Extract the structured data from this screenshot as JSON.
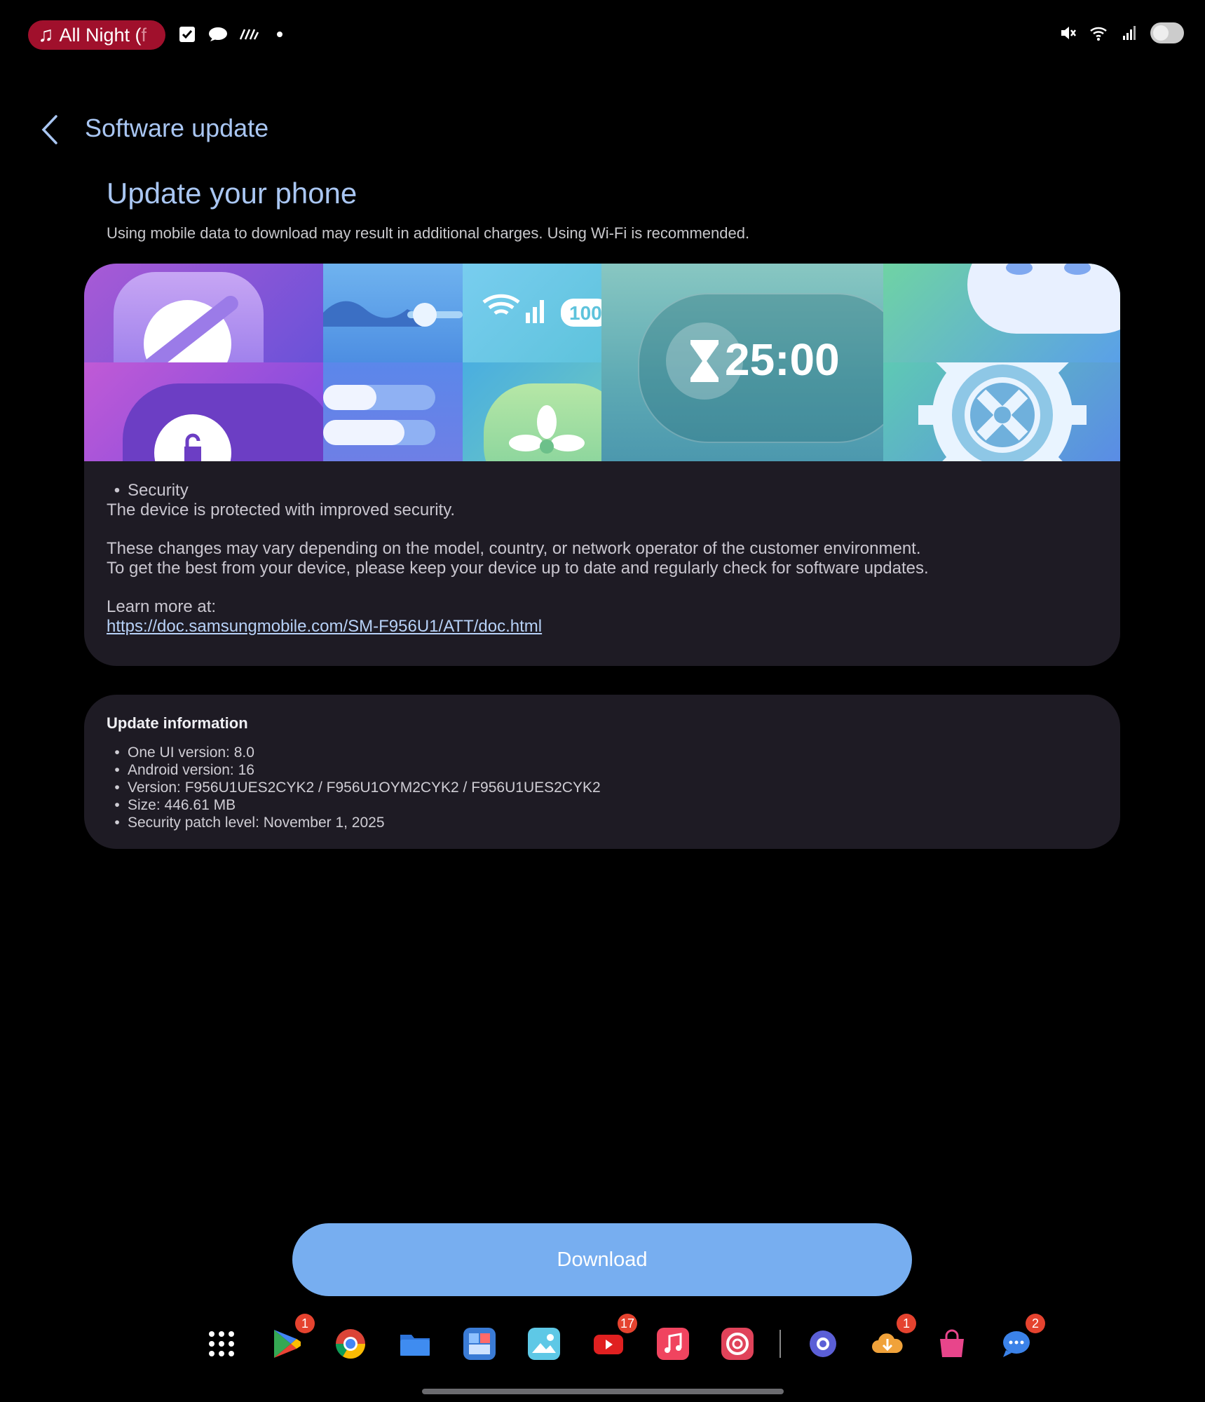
{
  "status_bar": {
    "music_label": "All Night (",
    "music_label_fade": "f",
    "left_icons": [
      "note-icon",
      "checkbox-icon",
      "chat-bubble-icon",
      "stripes-icon",
      "dot-icon"
    ],
    "right_icons": [
      "mute-icon",
      "wifi-icon",
      "signal-icon",
      "battery-toggle-icon"
    ]
  },
  "header": {
    "title": "Software update"
  },
  "main": {
    "heading": "Update your phone",
    "note": "Using mobile data to download may result in additional charges. Using Wi-Fi is recommended.",
    "banner": {
      "timer_text": "25:00",
      "battery_text": "100"
    },
    "release_notes": {
      "bullet_title": "Security",
      "bullet_body": "The device is protected with improved security.",
      "para1_line1": "These changes may vary depending on the model, country, or network operator of the customer environment.",
      "para1_line2": "To get the best from your device, please keep your device up to date and regularly check for software updates.",
      "learn_more": "Learn more at:",
      "link": "https://doc.samsungmobile.com/SM-F956U1/ATT/doc.html"
    },
    "update_info": {
      "title": "Update information",
      "items": [
        "One UI version: 8.0",
        "Android version: 16",
        "Version: F956U1UES2CYK2 / F956U1OYM2CYK2 / F956U1UES2CYK2",
        "Size: 446.61 MB",
        "Security patch level: November 1, 2025"
      ]
    }
  },
  "download_label": "Download",
  "taskbar": {
    "apps": [
      {
        "name": "apps-grid-icon",
        "badge": ""
      },
      {
        "name": "play-store-icon",
        "badge": "1"
      },
      {
        "name": "chrome-icon",
        "badge": ""
      },
      {
        "name": "files-icon",
        "badge": ""
      },
      {
        "name": "stack-app-icon",
        "badge": ""
      },
      {
        "name": "gallery-icon",
        "badge": ""
      },
      {
        "name": "youtube-icon",
        "badge": "17"
      },
      {
        "name": "music-icon",
        "badge": ""
      },
      {
        "name": "pocket-casts-icon",
        "badge": ""
      },
      {
        "name": "settings-icon",
        "badge": ""
      },
      {
        "name": "cloud-download-icon",
        "badge": "1"
      },
      {
        "name": "galaxy-store-icon",
        "badge": ""
      },
      {
        "name": "messages-icon",
        "badge": "2"
      }
    ]
  },
  "colors": {
    "accent": "#a9c6f2",
    "card_bg": "#1e1b24",
    "download_button": "#77aef0",
    "badge": "#e5432f",
    "music_pill": "#a0102c"
  }
}
